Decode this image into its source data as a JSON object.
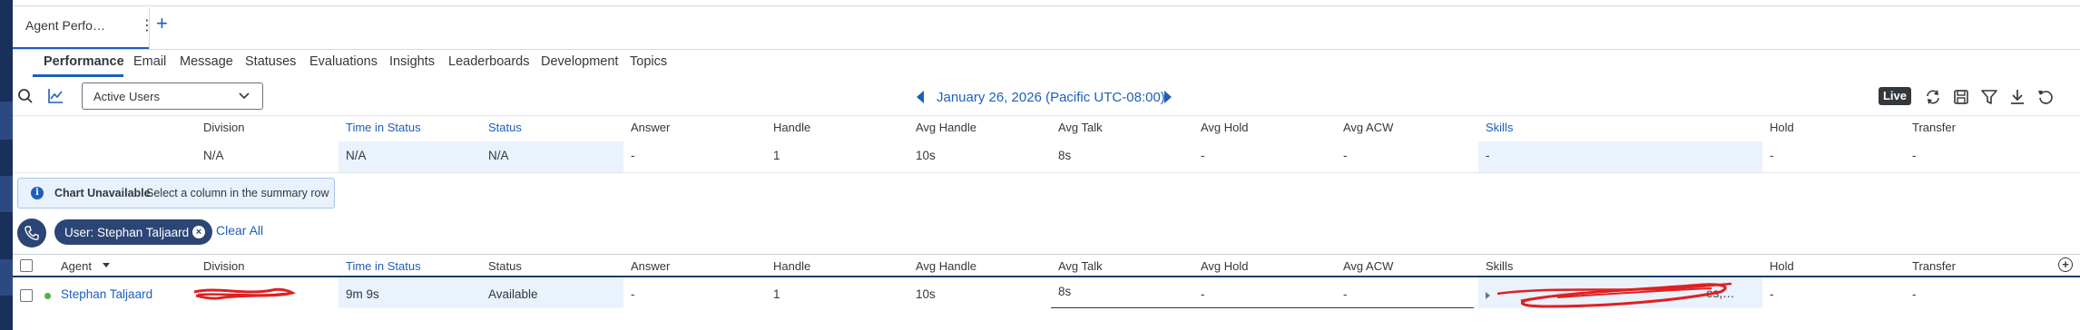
{
  "page_tab": {
    "label": "Agent Perfo…",
    "menu_icon": "kebab-icon",
    "add_icon": "plus-icon"
  },
  "nav_tabs": [
    "Performance",
    "Email",
    "Message",
    "Statuses",
    "Evaluations",
    "Insights",
    "Leaderboards",
    "Development",
    "Topics"
  ],
  "active_tab": "Performance",
  "toolbar": {
    "search_icon": "search-icon",
    "chart_icon": "line-chart-icon",
    "filter_dropdown": "Active Users",
    "date_label": "January 26, 2026 (Pacific UTC-08:00)",
    "live_label": "Live",
    "right_icons": [
      "refresh-icon",
      "save-icon",
      "filter-icon",
      "download-icon",
      "reset-icon"
    ]
  },
  "summary": {
    "headers": [
      "Division",
      "Time in Status",
      "Status",
      "Answer",
      "Handle",
      "Avg Handle",
      "Avg Talk",
      "Avg Hold",
      "Avg ACW",
      "Skills",
      "Hold",
      "Transfer"
    ],
    "values": [
      "N/A",
      "N/A",
      "N/A",
      "-",
      "1",
      "10s",
      "8s",
      "-",
      "-",
      "-",
      "-",
      "-"
    ]
  },
  "chart_message": {
    "title": "Chart Unavailable",
    "text": "Select a column in the summary row"
  },
  "filters": {
    "user_pill": "User: Stephan Taljaard",
    "clear_all": "Clear All"
  },
  "table": {
    "headers": [
      "Agent",
      "Division",
      "Time in Status",
      "Status",
      "Answer",
      "Handle",
      "Avg Handle",
      "Avg Talk",
      "Avg Hold",
      "Avg ACW",
      "Skills",
      "Hold",
      "Transfer"
    ],
    "row": {
      "agent": "Stephan Taljaard",
      "time_in_status": "9m 9s",
      "status": "Available",
      "answer": "-",
      "handle": "1",
      "avg_handle": "10s",
      "avg_talk": "8s",
      "avg_hold": "-",
      "avg_acw": "-",
      "skills_tail": "es,…",
      "hold": "-",
      "transfer": "-"
    }
  },
  "colors": {
    "accent": "#1d5fba",
    "nav": "#18305a",
    "pill": "#2b4575",
    "highlight": "#eaf2fd",
    "redaction": "#e02020",
    "online": "#4caf50"
  }
}
